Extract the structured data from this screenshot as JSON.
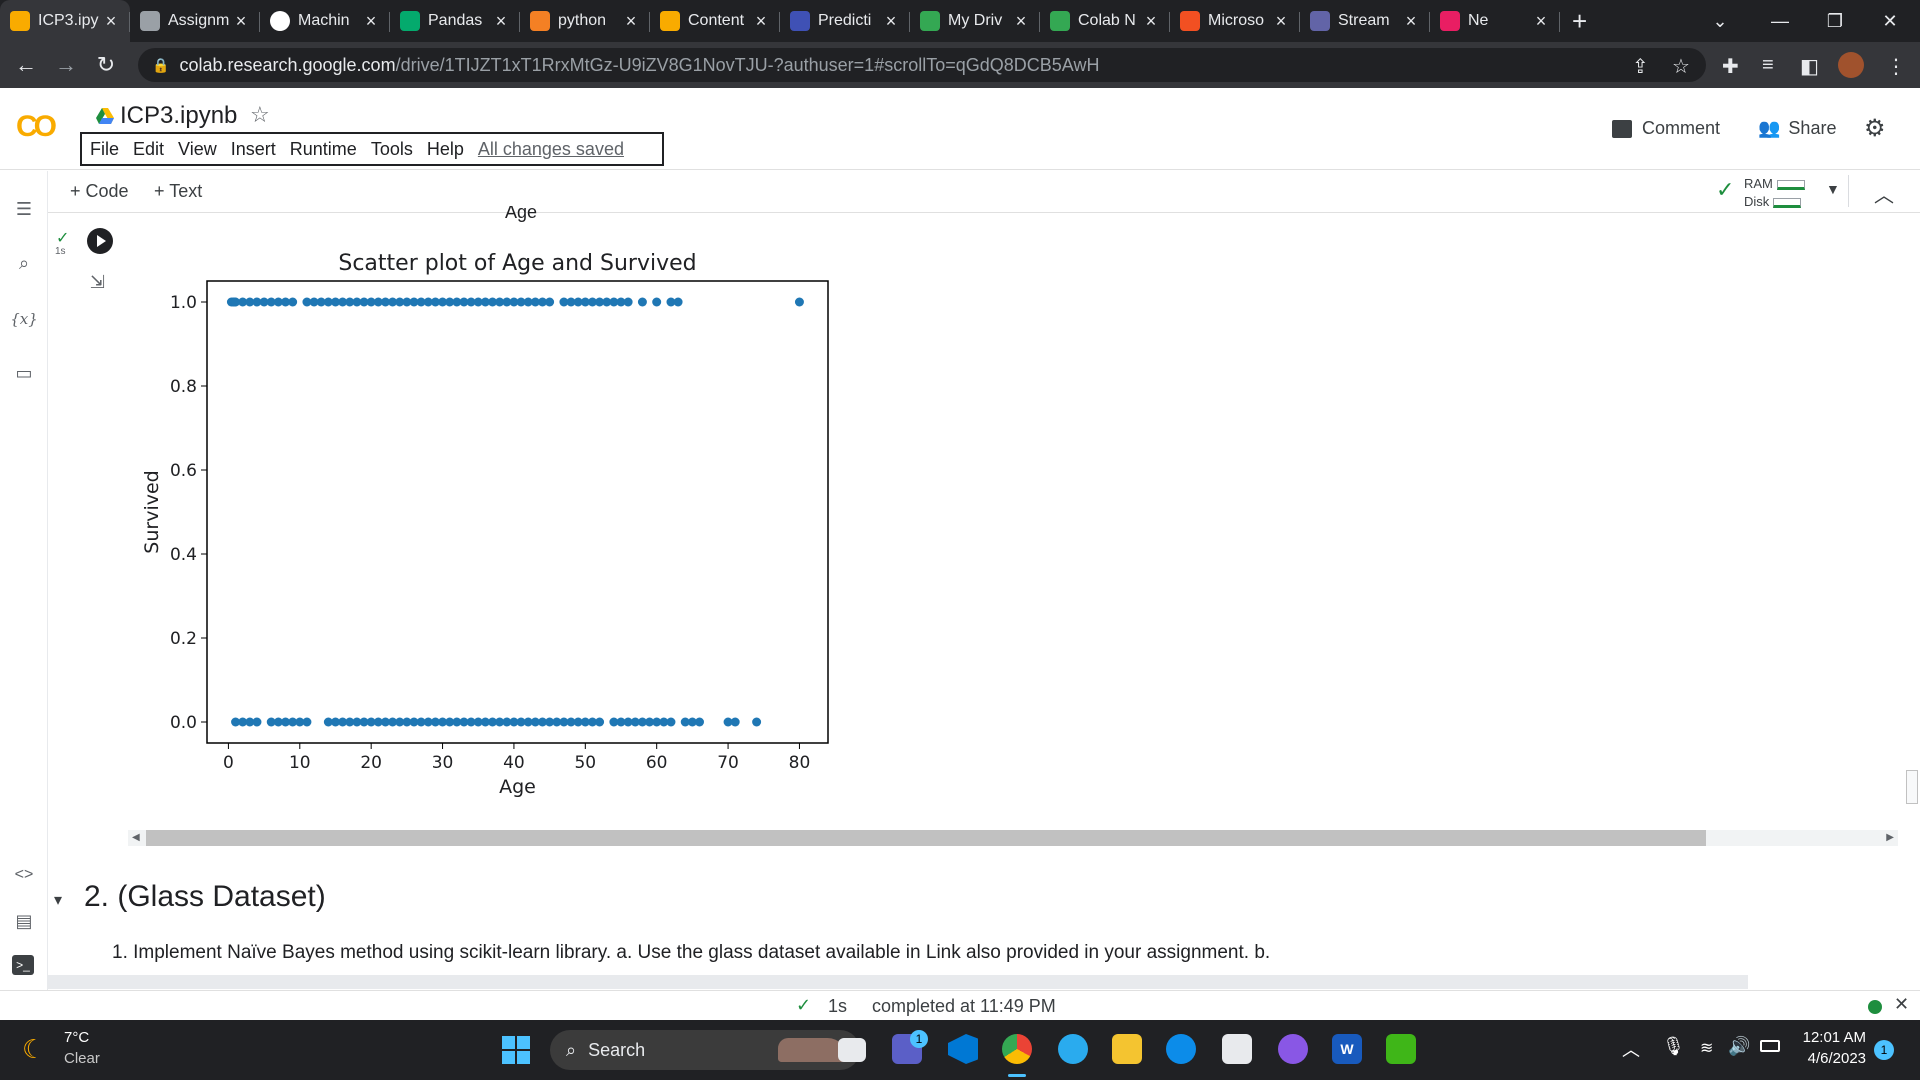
{
  "browser": {
    "tabs": [
      {
        "label": "ICP3.ipy",
        "active": true,
        "icon": "colab-icon"
      },
      {
        "label": "Assignm",
        "icon": "globe-icon"
      },
      {
        "label": "Machin",
        "icon": "github-icon"
      },
      {
        "label": "Pandas",
        "icon": "w3-icon"
      },
      {
        "label": "python",
        "icon": "stackoverflow-icon"
      },
      {
        "label": "Content",
        "icon": "pencil-icon"
      },
      {
        "label": "Predicti",
        "icon": "tds-icon"
      },
      {
        "label": "My Driv",
        "icon": "drive-icon"
      },
      {
        "label": "Colab N",
        "icon": "drive-icon"
      },
      {
        "label": "Microso",
        "icon": "microsoft-icon"
      },
      {
        "label": "Stream",
        "icon": "stream-icon"
      },
      {
        "label": "Ne",
        "icon": "play-icon"
      }
    ],
    "url_host": "colab.research.google.com",
    "url_path": "/drive/1TIJZT1xT1RrxMtGz-U9iZV8G1NovTJU-?authuser=1#scrollTo=qGdQ8DCB5AwH"
  },
  "colab": {
    "logo": "CO",
    "title": "ICP3.ipynb",
    "menu": [
      "File",
      "Edit",
      "View",
      "Insert",
      "Runtime",
      "Tools",
      "Help"
    ],
    "saved_status": "All changes saved",
    "comment_label": "Comment",
    "share_label": "Share",
    "add_code": "+ Code",
    "add_text": "+ Text",
    "ram_label": "RAM",
    "disk_label": "Disk"
  },
  "cell": {
    "exec_time": "1s",
    "prev_axis_label": "Age"
  },
  "chart_data": {
    "type": "scatter",
    "title": "Scatter plot of Age and Survived",
    "xlabel": "Age",
    "ylabel": "Survived",
    "xlim": [
      -3,
      84
    ],
    "ylim": [
      -0.05,
      1.05
    ],
    "xticks": [
      "0",
      "10",
      "20",
      "30",
      "40",
      "50",
      "60",
      "70",
      "80"
    ],
    "yticks": [
      "0.0",
      "0.2",
      "0.4",
      "0.6",
      "0.8",
      "1.0"
    ],
    "color": "#1f77b4",
    "series": [
      {
        "values": [
          {
            "x": 0.42,
            "y": 1
          },
          {
            "x": 0.67,
            "y": 1
          },
          {
            "x": 0.75,
            "y": 1
          },
          {
            "x": 0.83,
            "y": 1
          },
          {
            "x": 0.92,
            "y": 1
          },
          {
            "x": 1,
            "y": 1
          },
          {
            "x": 2,
            "y": 1
          },
          {
            "x": 3,
            "y": 1
          },
          {
            "x": 4,
            "y": 1
          },
          {
            "x": 5,
            "y": 1
          },
          {
            "x": 6,
            "y": 1
          },
          {
            "x": 7,
            "y": 1
          },
          {
            "x": 8,
            "y": 1
          },
          {
            "x": 9,
            "y": 1
          },
          {
            "x": 11,
            "y": 1
          },
          {
            "x": 12,
            "y": 1
          },
          {
            "x": 13,
            "y": 1
          },
          {
            "x": 14,
            "y": 1
          },
          {
            "x": 15,
            "y": 1
          },
          {
            "x": 16,
            "y": 1
          },
          {
            "x": 17,
            "y": 1
          },
          {
            "x": 18,
            "y": 1
          },
          {
            "x": 19,
            "y": 1
          },
          {
            "x": 20,
            "y": 1
          },
          {
            "x": 21,
            "y": 1
          },
          {
            "x": 22,
            "y": 1
          },
          {
            "x": 23,
            "y": 1
          },
          {
            "x": 24,
            "y": 1
          },
          {
            "x": 25,
            "y": 1
          },
          {
            "x": 26,
            "y": 1
          },
          {
            "x": 27,
            "y": 1
          },
          {
            "x": 28,
            "y": 1
          },
          {
            "x": 29,
            "y": 1
          },
          {
            "x": 30,
            "y": 1
          },
          {
            "x": 31,
            "y": 1
          },
          {
            "x": 32,
            "y": 1
          },
          {
            "x": 33,
            "y": 1
          },
          {
            "x": 34,
            "y": 1
          },
          {
            "x": 35,
            "y": 1
          },
          {
            "x": 36,
            "y": 1
          },
          {
            "x": 37,
            "y": 1
          },
          {
            "x": 38,
            "y": 1
          },
          {
            "x": 39,
            "y": 1
          },
          {
            "x": 40,
            "y": 1
          },
          {
            "x": 41,
            "y": 1
          },
          {
            "x": 42,
            "y": 1
          },
          {
            "x": 43,
            "y": 1
          },
          {
            "x": 44,
            "y": 1
          },
          {
            "x": 45,
            "y": 1
          },
          {
            "x": 47,
            "y": 1
          },
          {
            "x": 48,
            "y": 1
          },
          {
            "x": 49,
            "y": 1
          },
          {
            "x": 50,
            "y": 1
          },
          {
            "x": 51,
            "y": 1
          },
          {
            "x": 52,
            "y": 1
          },
          {
            "x": 53,
            "y": 1
          },
          {
            "x": 54,
            "y": 1
          },
          {
            "x": 55,
            "y": 1
          },
          {
            "x": 56,
            "y": 1
          },
          {
            "x": 58,
            "y": 1
          },
          {
            "x": 60,
            "y": 1
          },
          {
            "x": 62,
            "y": 1
          },
          {
            "x": 63,
            "y": 1
          },
          {
            "x": 80,
            "y": 1
          },
          {
            "x": 1,
            "y": 0
          },
          {
            "x": 2,
            "y": 0
          },
          {
            "x": 3,
            "y": 0
          },
          {
            "x": 4,
            "y": 0
          },
          {
            "x": 6,
            "y": 0
          },
          {
            "x": 7,
            "y": 0
          },
          {
            "x": 8,
            "y": 0
          },
          {
            "x": 9,
            "y": 0
          },
          {
            "x": 10,
            "y": 0
          },
          {
            "x": 11,
            "y": 0
          },
          {
            "x": 14,
            "y": 0
          },
          {
            "x": 15,
            "y": 0
          },
          {
            "x": 16,
            "y": 0
          },
          {
            "x": 17,
            "y": 0
          },
          {
            "x": 18,
            "y": 0
          },
          {
            "x": 19,
            "y": 0
          },
          {
            "x": 20,
            "y": 0
          },
          {
            "x": 21,
            "y": 0
          },
          {
            "x": 22,
            "y": 0
          },
          {
            "x": 23,
            "y": 0
          },
          {
            "x": 24,
            "y": 0
          },
          {
            "x": 25,
            "y": 0
          },
          {
            "x": 26,
            "y": 0
          },
          {
            "x": 27,
            "y": 0
          },
          {
            "x": 28,
            "y": 0
          },
          {
            "x": 29,
            "y": 0
          },
          {
            "x": 30,
            "y": 0
          },
          {
            "x": 31,
            "y": 0
          },
          {
            "x": 32,
            "y": 0
          },
          {
            "x": 33,
            "y": 0
          },
          {
            "x": 34,
            "y": 0
          },
          {
            "x": 35,
            "y": 0
          },
          {
            "x": 36,
            "y": 0
          },
          {
            "x": 37,
            "y": 0
          },
          {
            "x": 38,
            "y": 0
          },
          {
            "x": 39,
            "y": 0
          },
          {
            "x": 40,
            "y": 0
          },
          {
            "x": 41,
            "y": 0
          },
          {
            "x": 42,
            "y": 0
          },
          {
            "x": 43,
            "y": 0
          },
          {
            "x": 44,
            "y": 0
          },
          {
            "x": 45,
            "y": 0
          },
          {
            "x": 46,
            "y": 0
          },
          {
            "x": 47,
            "y": 0
          },
          {
            "x": 48,
            "y": 0
          },
          {
            "x": 49,
            "y": 0
          },
          {
            "x": 50,
            "y": 0
          },
          {
            "x": 51,
            "y": 0
          },
          {
            "x": 52,
            "y": 0
          },
          {
            "x": 54,
            "y": 0
          },
          {
            "x": 55,
            "y": 0
          },
          {
            "x": 56,
            "y": 0
          },
          {
            "x": 57,
            "y": 0
          },
          {
            "x": 58,
            "y": 0
          },
          {
            "x": 59,
            "y": 0
          },
          {
            "x": 60,
            "y": 0
          },
          {
            "x": 61,
            "y": 0
          },
          {
            "x": 62,
            "y": 0
          },
          {
            "x": 64,
            "y": 0
          },
          {
            "x": 65,
            "y": 0
          },
          {
            "x": 66,
            "y": 0
          },
          {
            "x": 70,
            "y": 0
          },
          {
            "x": 71,
            "y": 0
          },
          {
            "x": 74,
            "y": 0
          }
        ]
      }
    ]
  },
  "section": {
    "title": "2. (Glass Dataset)",
    "body": "1. Implement Naïve Bayes method using scikit-learn library. a. Use the glass dataset available in Link also provided in your assignment. b."
  },
  "status": {
    "time": "1s",
    "completed": "completed at 11:49 PM"
  },
  "taskbar": {
    "weather_temp": "7°C",
    "weather_desc": "Clear",
    "search_label": "Search",
    "clock_time": "12:01 AM",
    "clock_date": "4/6/2023",
    "notif_count": "1",
    "teams_badge": "1"
  }
}
